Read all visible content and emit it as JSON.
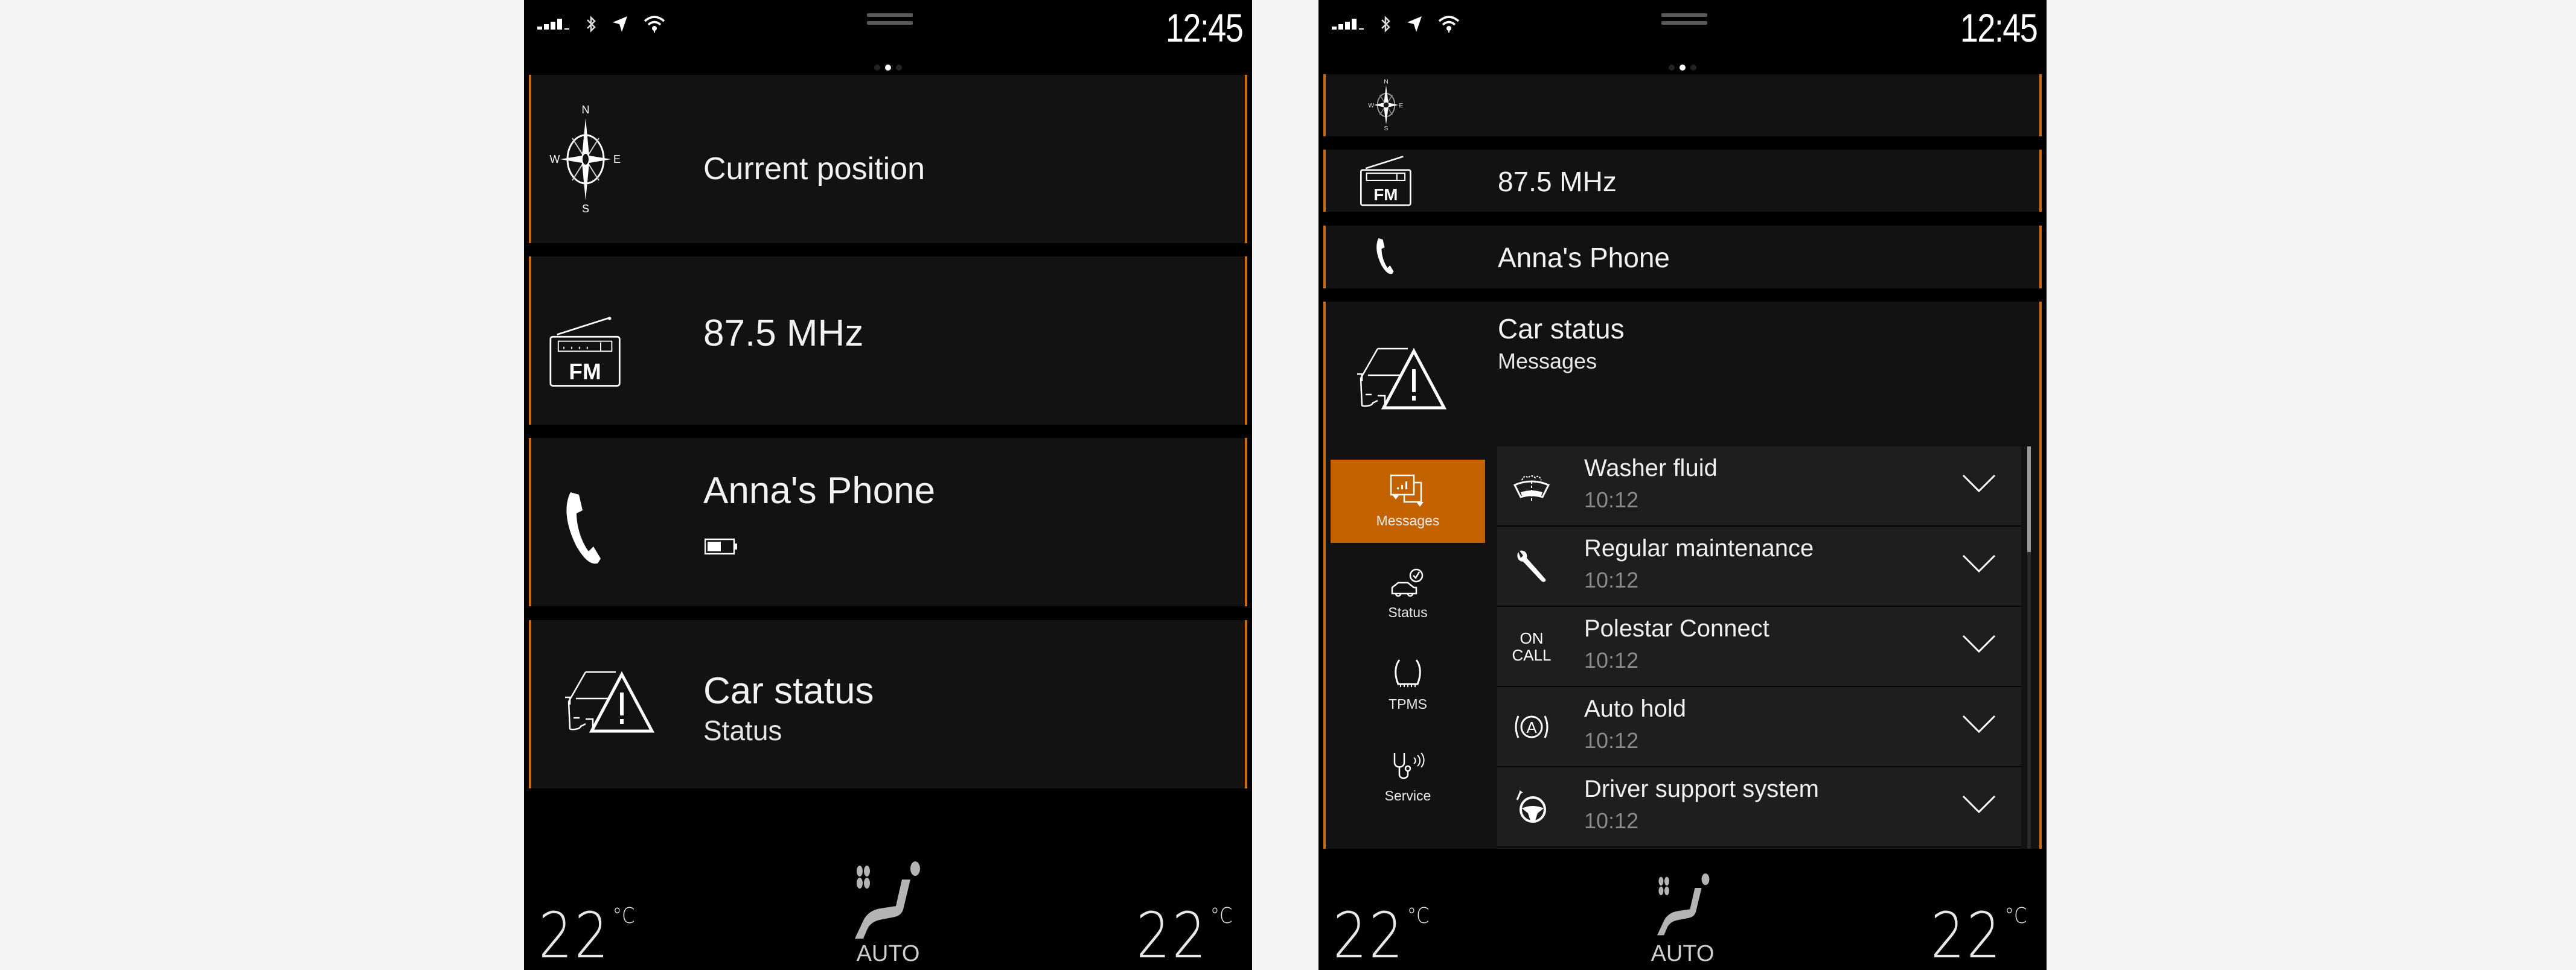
{
  "theme": {
    "accent": "#C46200",
    "card_border": "#D06A10",
    "card_bg": "#121212",
    "screen_bg": "#000000",
    "page_bg": "#F4F4F4"
  },
  "left": {
    "status_bar": {
      "time": "12:45",
      "icons": [
        "signal-icon",
        "bluetooth-icon",
        "location-icon",
        "wifi-icon"
      ],
      "pager": {
        "pages": 3,
        "active": 2
      }
    },
    "cards": [
      {
        "icon": "compass-icon",
        "title": "Current position",
        "compass": {
          "n": "N",
          "s": "S",
          "e": "E",
          "w": "W"
        }
      },
      {
        "icon": "fm-radio-icon",
        "title": "87.5 MHz",
        "icon_label": "FM"
      },
      {
        "icon": "phone-icon",
        "title": "Anna's Phone",
        "battery_level": 0.5
      },
      {
        "icon": "car-warning-icon",
        "title": "Car status",
        "subtitle": "Status"
      }
    ],
    "climate": {
      "left_temp": "22",
      "right_temp": "22",
      "unit": "°C",
      "mode": "AUTO"
    }
  },
  "right": {
    "status_bar": {
      "time": "12:45",
      "icons": [
        "signal-icon",
        "bluetooth-icon",
        "location-icon",
        "wifi-icon"
      ],
      "pager": {
        "pages": 3,
        "active": 2
      }
    },
    "cards": [
      {
        "icon": "compass-icon",
        "compass": {
          "n": "N",
          "s": "S",
          "e": "E",
          "w": "W"
        }
      },
      {
        "icon": "fm-radio-icon",
        "title": "87.5 MHz",
        "icon_label": "FM"
      },
      {
        "icon": "phone-icon",
        "title": "Anna's Phone"
      },
      {
        "icon": "car-warning-icon",
        "title": "Car status",
        "subtitle": "Messages"
      }
    ],
    "car_status_tabs": [
      {
        "label": "Messages",
        "icon": "messages-icon",
        "active": true
      },
      {
        "label": "Status",
        "icon": "car-check-icon",
        "active": false
      },
      {
        "label": "TPMS",
        "icon": "tire-pressure-icon",
        "active": false
      },
      {
        "label": "Service",
        "icon": "service-icon",
        "active": false
      }
    ],
    "messages": [
      {
        "title": "Washer fluid",
        "time": "10:12",
        "icon": "washer-fluid-icon"
      },
      {
        "title": "Regular maintenance",
        "time": "10:12",
        "icon": "wrench-icon"
      },
      {
        "title": "Polestar Connect",
        "time": "10:12",
        "icon": "on-call-icon",
        "icon_text": [
          "ON",
          "CALL"
        ]
      },
      {
        "title": "Auto hold",
        "time": "10:12",
        "icon": "auto-hold-icon",
        "icon_text": [
          "A"
        ]
      },
      {
        "title": "Driver support system",
        "time": "10:12",
        "icon": "steering-wheel-icon"
      }
    ],
    "scroll_position": 0.0,
    "climate": {
      "left_temp": "22",
      "right_temp": "22",
      "unit": "°C",
      "mode": "AUTO"
    }
  }
}
